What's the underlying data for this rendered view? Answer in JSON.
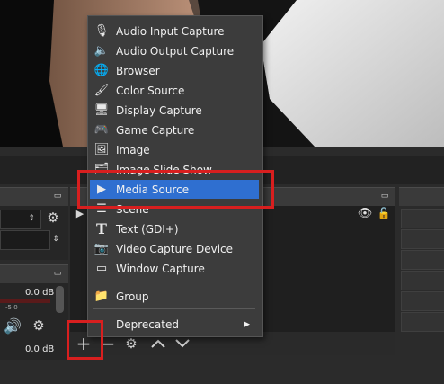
{
  "menu": {
    "items": [
      {
        "label": "Audio Input Capture",
        "icon": "microphone-icon"
      },
      {
        "label": "Audio Output Capture",
        "icon": "speaker-icon"
      },
      {
        "label": "Browser",
        "icon": "globe-icon"
      },
      {
        "label": "Color Source",
        "icon": "paintbrush-icon"
      },
      {
        "label": "Display Capture",
        "icon": "monitor-icon"
      },
      {
        "label": "Game Capture",
        "icon": "gamepad-icon"
      },
      {
        "label": "Image",
        "icon": "image-icon"
      },
      {
        "label": "Image Slide Show",
        "icon": "slideshow-icon"
      },
      {
        "label": "Media Source",
        "icon": "play-icon"
      },
      {
        "label": "Scene",
        "icon": "list-icon"
      },
      {
        "label": "Text (GDI+)",
        "icon": "text-icon"
      },
      {
        "label": "Video Capture Device",
        "icon": "camera-icon"
      },
      {
        "label": "Window Capture",
        "icon": "window-icon"
      },
      {
        "label": "Group",
        "icon": "folder-icon"
      },
      {
        "label": "Deprecated",
        "icon": "submenu-arrow-icon"
      }
    ],
    "selected_index": 8
  },
  "mixer": {
    "db_top": "0.0 dB",
    "db_bottom": "0.0 dB",
    "scale_marks": "-5      0"
  },
  "toolbar": {
    "add_symbol": "+",
    "remove_symbol": "−"
  },
  "colors": {
    "highlight": "#2f6fd0",
    "annotation": "#d81f1f"
  }
}
